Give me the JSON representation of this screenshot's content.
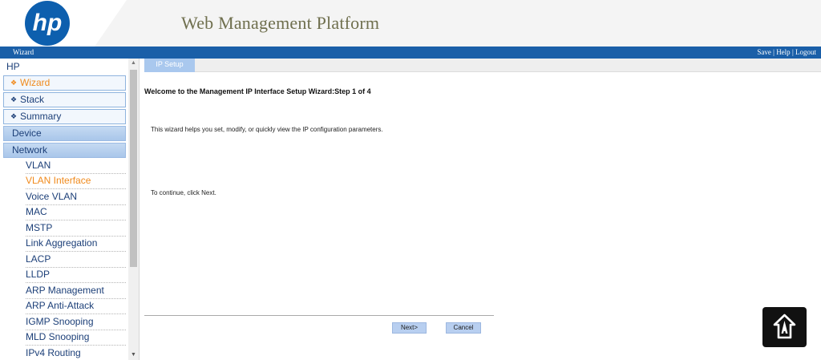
{
  "header": {
    "logo_text": "hp",
    "title": "Web Management Platform"
  },
  "topbar": {
    "breadcrumb": "Wizard",
    "links": {
      "save": "Save",
      "help": "Help",
      "logout": "Logout",
      "separator": " | "
    }
  },
  "sidebar": {
    "root": "HP",
    "top_items": [
      {
        "label": "Wizard",
        "active": true
      },
      {
        "label": "Stack",
        "active": false
      },
      {
        "label": "Summary",
        "active": false
      }
    ],
    "sections": [
      {
        "label": "Device"
      },
      {
        "label": "Network"
      }
    ],
    "network_items": [
      {
        "label": "VLAN",
        "active": false
      },
      {
        "label": "VLAN Interface",
        "active": true
      },
      {
        "label": "Voice VLAN",
        "active": false
      },
      {
        "label": "MAC",
        "active": false
      },
      {
        "label": "MSTP",
        "active": false
      },
      {
        "label": "Link Aggregation",
        "active": false
      },
      {
        "label": "LACP",
        "active": false
      },
      {
        "label": "LLDP",
        "active": false
      },
      {
        "label": "ARP Management",
        "active": false
      },
      {
        "label": "ARP Anti-Attack",
        "active": false
      },
      {
        "label": "IGMP Snooping",
        "active": false
      },
      {
        "label": "MLD Snooping",
        "active": false
      },
      {
        "label": "IPv4 Routing",
        "active": false
      }
    ],
    "diamond_glyph": "❖"
  },
  "main": {
    "tab": "IP Setup",
    "heading": "Welcome to the Management IP Interface Setup Wizard:Step 1 of 4",
    "description": "This wizard helps you set, modify, or quickly view the IP configuration parameters.",
    "continue_text": "To continue, click Next.",
    "buttons": {
      "next": "Next>",
      "cancel": "Cancel"
    }
  },
  "colors": {
    "brand_blue": "#1a5fa8",
    "active_orange": "#f08a1c",
    "nav_text": "#1c3f78"
  }
}
